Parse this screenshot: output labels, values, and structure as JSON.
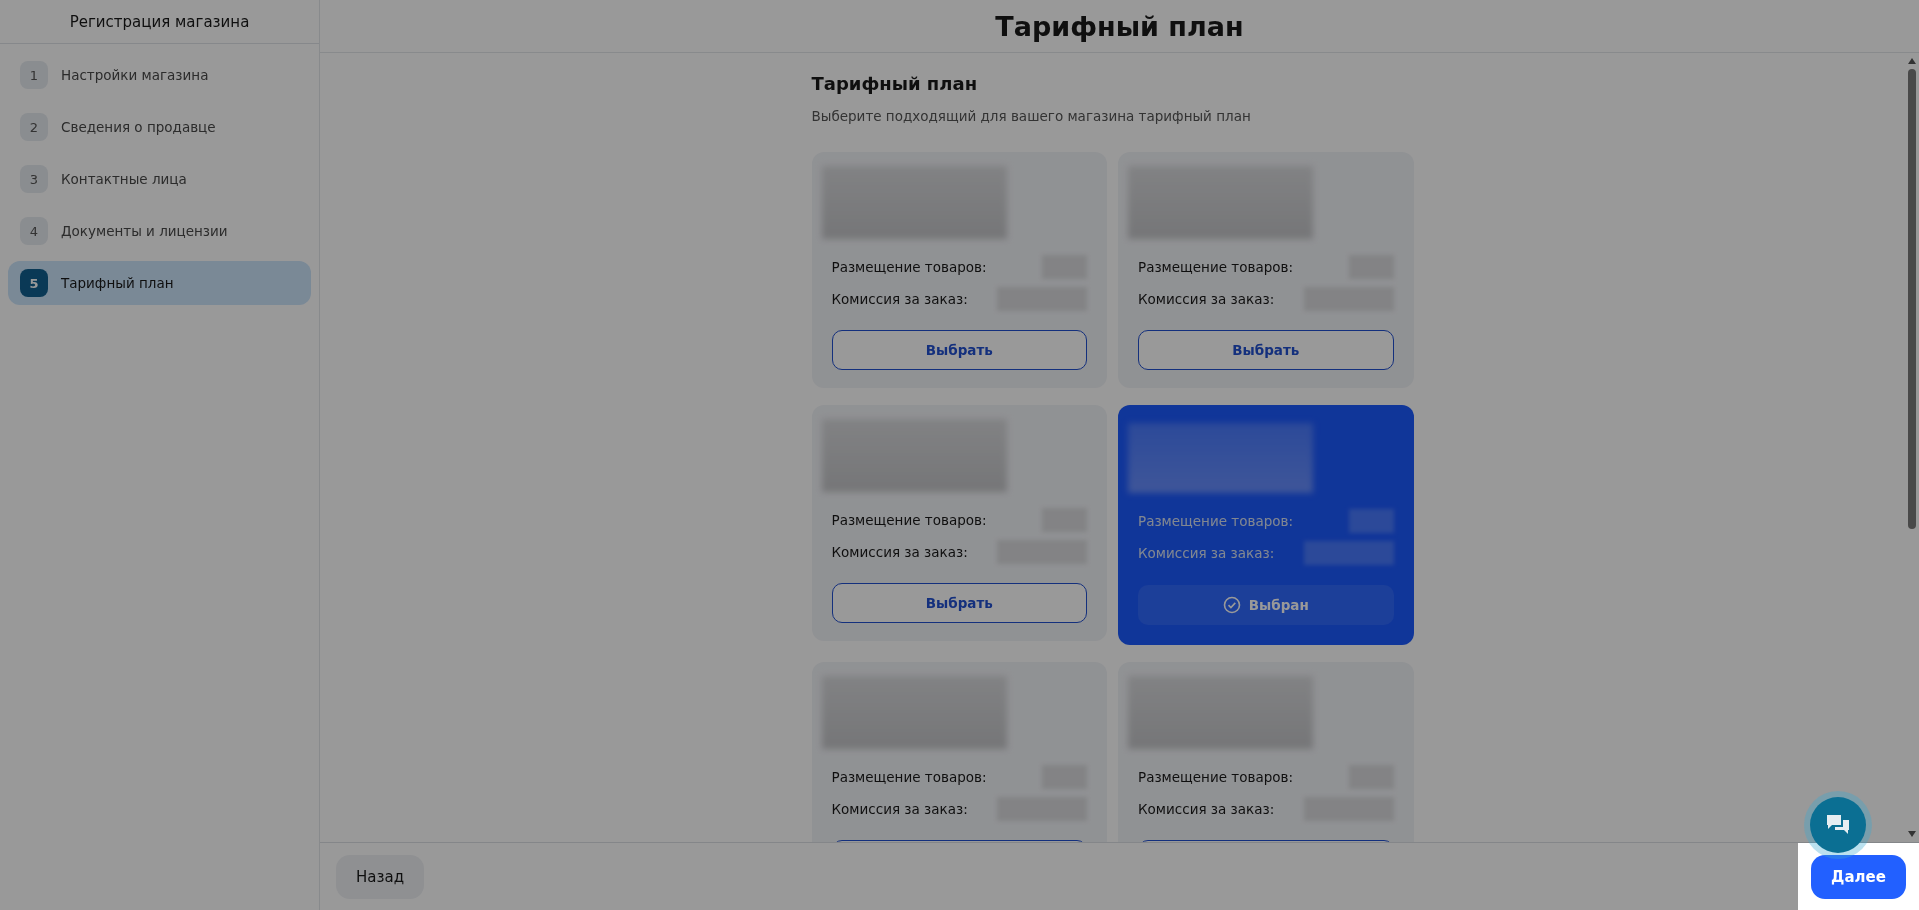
{
  "sidebar": {
    "title": "Регистрация магазина",
    "steps": [
      {
        "number": "1",
        "label": "Настройки магазина",
        "selected": false
      },
      {
        "number": "2",
        "label": "Сведения о продавце",
        "selected": false
      },
      {
        "number": "3",
        "label": "Контактные лица",
        "selected": false
      },
      {
        "number": "4",
        "label": "Документы и лицензии",
        "selected": false
      },
      {
        "number": "5",
        "label": "Тарифный план",
        "selected": true
      }
    ]
  },
  "header": {
    "title": "Тарифный план"
  },
  "content": {
    "heading": "Тарифный план",
    "subtitle": "Выберите подходящий для вашего магазина тарифный план",
    "plans": [
      {
        "placement_label": "Размещение товаров:",
        "commission_label": "Комиссия за заказ:",
        "selected": false,
        "button": "Выбрать"
      },
      {
        "placement_label": "Размещение товаров:",
        "commission_label": "Комиссия за заказ:",
        "selected": false,
        "button": "Выбрать"
      },
      {
        "placement_label": "Размещение товаров:",
        "commission_label": "Комиссия за заказ:",
        "selected": false,
        "button": "Выбрать"
      },
      {
        "placement_label": "Размещение товаров:",
        "commission_label": "Комиссия за заказ:",
        "selected": true,
        "button": "Выбран"
      },
      {
        "placement_label": "Размещение товаров:",
        "commission_label": "Комиссия за заказ:",
        "selected": false
      },
      {
        "placement_label": "Размещение товаров:",
        "commission_label": "Комиссия за заказ:",
        "selected": false
      }
    ]
  },
  "footer": {
    "back_button": "Назад",
    "next_button": "Далее"
  }
}
